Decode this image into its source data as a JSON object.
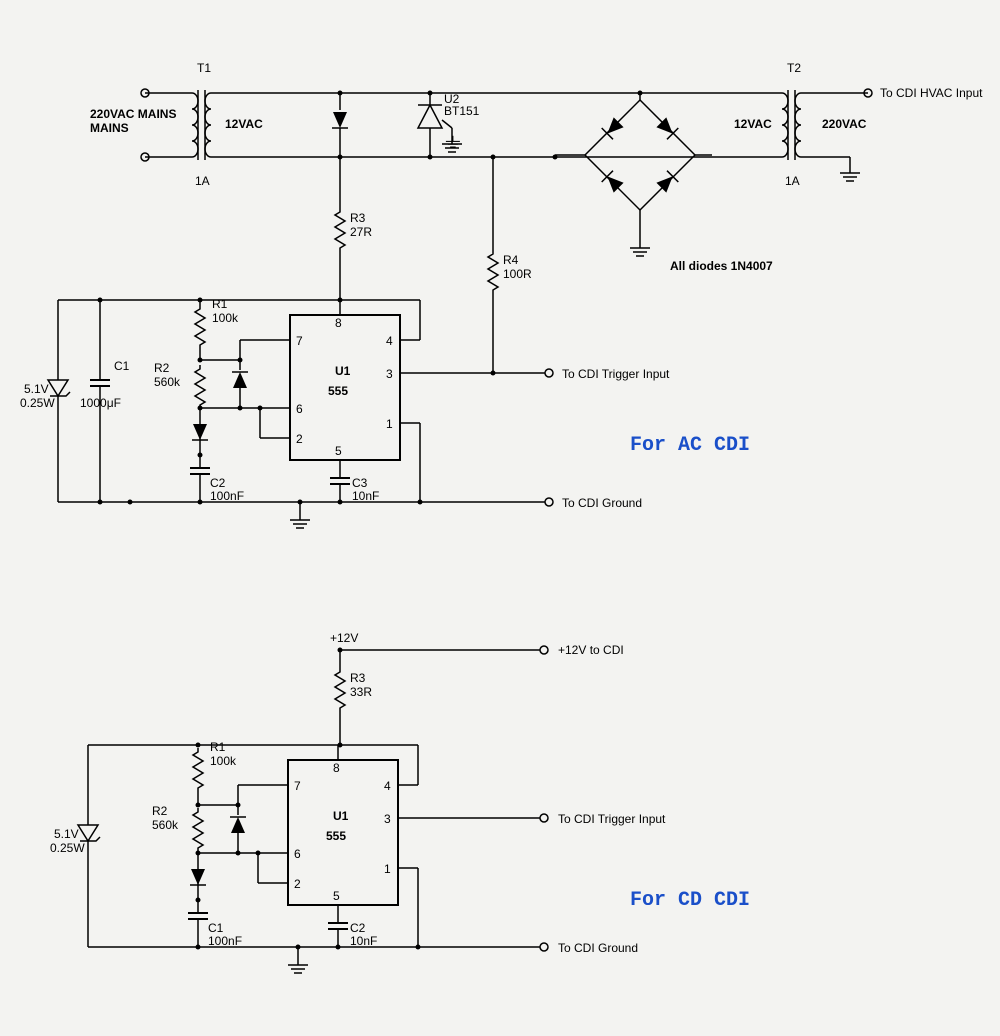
{
  "ac": {
    "title": "For AC CDI",
    "t1": {
      "label": "T1",
      "primary": "220VAC\nMAINS",
      "secondary": "12VAC",
      "current": "1A"
    },
    "t2": {
      "label": "T2",
      "primary": "220VAC",
      "secondary": "12VAC",
      "current": "1A"
    },
    "u1": {
      "ref": "U1",
      "part": "555"
    },
    "u2": {
      "ref": "U2",
      "part": "BT151"
    },
    "r1": {
      "ref": "R1",
      "val": "100k"
    },
    "r2": {
      "ref": "R2",
      "val": "560k"
    },
    "r3": {
      "ref": "R3",
      "val": "27R"
    },
    "r4": {
      "ref": "R4",
      "val": "100R"
    },
    "c1": {
      "ref": "C1",
      "val": "1000μF"
    },
    "c2": {
      "ref": "C2",
      "val": "100nF"
    },
    "c3": {
      "ref": "C3",
      "val": "10nF"
    },
    "zener": {
      "v": "5.1V",
      "p": "0.25W"
    },
    "diode_note": "All diodes 1N4007",
    "out_hvac": "To CDI HVAC Input",
    "out_trigger": "To CDI Trigger Input",
    "out_gnd": "To CDI Ground",
    "pins": {
      "p1": "1",
      "p2": "2",
      "p3": "3",
      "p4": "4",
      "p5": "5",
      "p6": "6",
      "p7": "7",
      "p8": "8"
    }
  },
  "dc": {
    "title": "For CD CDI",
    "supply": "+12V",
    "supply_to": "+12V to CDI",
    "u1": {
      "ref": "U1",
      "part": "555"
    },
    "r1": {
      "ref": "R1",
      "val": "100k"
    },
    "r2": {
      "ref": "R2",
      "val": "560k"
    },
    "r3": {
      "ref": "R3",
      "val": "33R"
    },
    "c1": {
      "ref": "C1",
      "val": "100nF"
    },
    "c2": {
      "ref": "C2",
      "val": "10nF"
    },
    "zener": {
      "v": "5.1V",
      "p": "0.25W"
    },
    "out_trigger": "To CDI Trigger Input",
    "out_gnd": "To CDI Ground",
    "pins": {
      "p1": "1",
      "p2": "2",
      "p3": "3",
      "p4": "4",
      "p5": "5",
      "p6": "6",
      "p7": "7",
      "p8": "8"
    }
  }
}
